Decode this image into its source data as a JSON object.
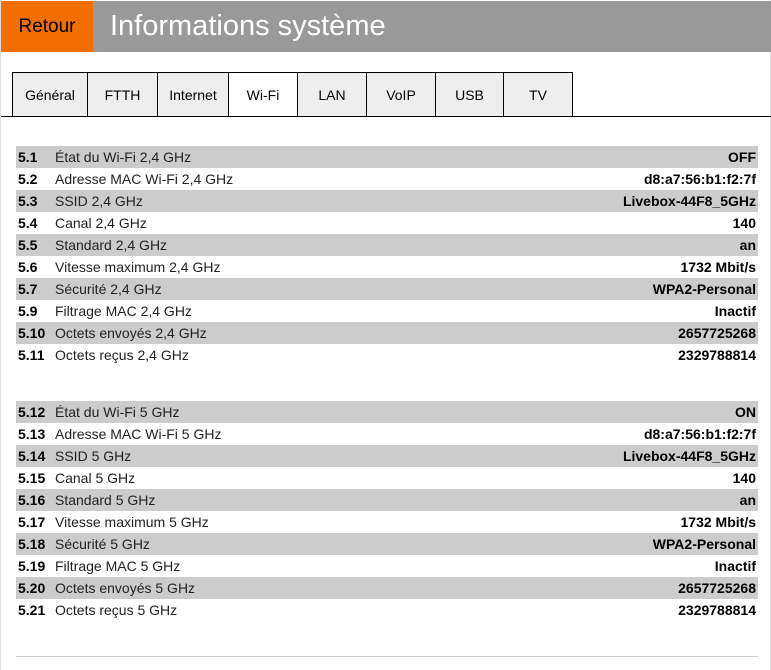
{
  "header": {
    "back_label": "Retour",
    "title": "Informations système"
  },
  "tabs": [
    {
      "label": "Général"
    },
    {
      "label": "FTTH"
    },
    {
      "label": "Internet"
    },
    {
      "label": "Wi-Fi",
      "active": true
    },
    {
      "label": "LAN"
    },
    {
      "label": "VoIP"
    },
    {
      "label": "USB"
    },
    {
      "label": "TV"
    }
  ],
  "groups": [
    [
      {
        "num": "5.1",
        "label": "État du Wi-Fi 2,4 GHz",
        "value": "OFF"
      },
      {
        "num": "5.2",
        "label": "Adresse MAC Wi-Fi 2,4 GHz",
        "value": "d8:a7:56:b1:f2:7f"
      },
      {
        "num": "5.3",
        "label": "SSID 2,4 GHz",
        "value": "Livebox-44F8_5GHz"
      },
      {
        "num": "5.4",
        "label": "Canal 2,4 GHz",
        "value": "140"
      },
      {
        "num": "5.5",
        "label": "Standard 2,4 GHz",
        "value": "an"
      },
      {
        "num": "5.6",
        "label": "Vitesse maximum 2,4 GHz",
        "value": "1732 Mbit/s"
      },
      {
        "num": "5.7",
        "label": "Sécurité 2,4 GHz",
        "value": "WPA2-Personal"
      },
      {
        "num": "5.9",
        "label": "Filtrage MAC 2,4 GHz",
        "value": "Inactif"
      },
      {
        "num": "5.10",
        "label": "Octets envoyés 2,4 GHz",
        "value": "2657725268"
      },
      {
        "num": "5.11",
        "label": "Octets reçus 2,4 GHz",
        "value": "2329788814"
      }
    ],
    [
      {
        "num": "5.12",
        "label": "État du Wi-Fi 5 GHz",
        "value": "ON"
      },
      {
        "num": "5.13",
        "label": "Adresse MAC Wi-Fi 5 GHz",
        "value": "d8:a7:56:b1:f2:7f"
      },
      {
        "num": "5.14",
        "label": "SSID 5 GHz",
        "value": "Livebox-44F8_5GHz"
      },
      {
        "num": "5.15",
        "label": "Canal 5 GHz",
        "value": "140"
      },
      {
        "num": "5.16",
        "label": "Standard 5 GHz",
        "value": "an"
      },
      {
        "num": "5.17",
        "label": "Vitesse maximum 5 GHz",
        "value": "1732 Mbit/s"
      },
      {
        "num": "5.18",
        "label": "Sécurité 5 GHz",
        "value": "WPA2-Personal"
      },
      {
        "num": "5.19",
        "label": "Filtrage MAC 5 GHz",
        "value": "Inactif"
      },
      {
        "num": "5.20",
        "label": "Octets envoyés 5 GHz",
        "value": "2657725268"
      },
      {
        "num": "5.21",
        "label": "Octets reçus 5 GHz",
        "value": "2329788814"
      }
    ]
  ]
}
